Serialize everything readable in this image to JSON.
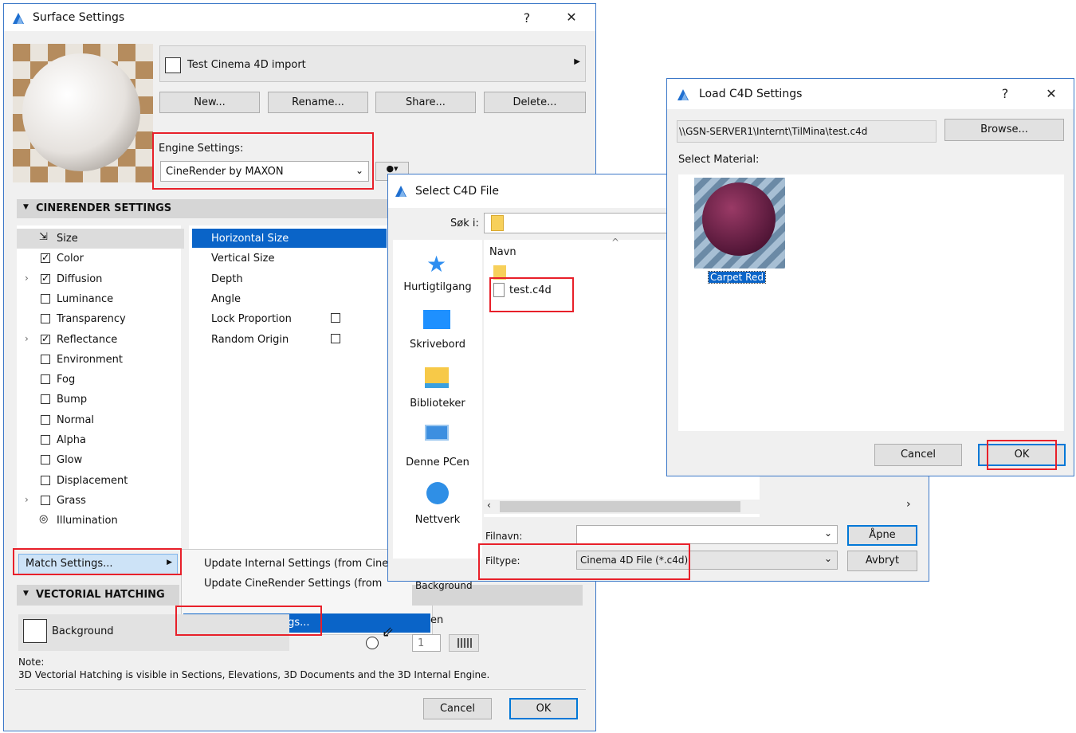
{
  "surface": {
    "title": "Surface Settings",
    "help": "?",
    "close": "✕",
    "material_name": "Test Cinema 4D import",
    "buttons": {
      "new": "New...",
      "rename": "Rename...",
      "share": "Share...",
      "delete": "Delete..."
    },
    "engine_label": "Engine Settings:",
    "engine_value": "CineRender by MAXON",
    "cinerender_header": "CINERENDER SETTINGS",
    "channels": [
      {
        "label": "Size",
        "checked": null
      },
      {
        "label": "Color",
        "checked": true
      },
      {
        "label": "Diffusion",
        "checked": true
      },
      {
        "label": "Luminance",
        "checked": false
      },
      {
        "label": "Transparency",
        "checked": false
      },
      {
        "label": "Reflectance",
        "checked": true
      },
      {
        "label": "Environment",
        "checked": false
      },
      {
        "label": "Fog",
        "checked": false
      },
      {
        "label": "Bump",
        "checked": false
      },
      {
        "label": "Normal",
        "checked": false
      },
      {
        "label": "Alpha",
        "checked": false
      },
      {
        "label": "Glow",
        "checked": false
      },
      {
        "label": "Displacement",
        "checked": false
      },
      {
        "label": "Grass",
        "checked": false
      },
      {
        "label": "Illumination",
        "checked": null
      }
    ],
    "params": [
      "Horizontal Size",
      "Vertical Size",
      "Depth",
      "Angle",
      "Lock Proportion",
      "Random Origin"
    ],
    "match_settings": "Match Settings...",
    "menu_items": [
      "Update Internal Settings (from Cine",
      "Update CineRender Settings (from",
      "Load C4D Settings..."
    ],
    "vectorial_header": "VECTORIAL HATCHING",
    "background_label": "Background",
    "bg_partial": "Background",
    "en_partial": "en",
    "spin_value": "1",
    "note_label": "Note:",
    "note_text": "3D Vectorial Hatching is visible in Sections, Elevations, 3D Documents and the 3D Internal Engine.",
    "cancel": "Cancel",
    "ok": "OK"
  },
  "select_file": {
    "title": "Select C4D File",
    "look_in_label": "Søk i:",
    "places": [
      "Hurtigtilgang",
      "Skrivebord",
      "Biblioteker",
      "Denne PCen",
      "Nettverk"
    ],
    "column_name": "Navn",
    "file_name": "test.c4d",
    "filename_label": "Filnavn:",
    "filename_value": "",
    "filetype_label": "Filtype:",
    "filetype_value": "Cinema 4D File (*.c4d)",
    "open": "Åpne",
    "cancel": "Avbryt"
  },
  "load_c4d": {
    "title": "Load C4D Settings",
    "help": "?",
    "close": "✕",
    "path": "\\\\GSN-SERVER1\\Internt\\TilMina\\test.c4d",
    "browse": "Browse...",
    "select_material": "Select Material:",
    "material_name": "Carpet Red",
    "cancel": "Cancel",
    "ok": "OK"
  }
}
